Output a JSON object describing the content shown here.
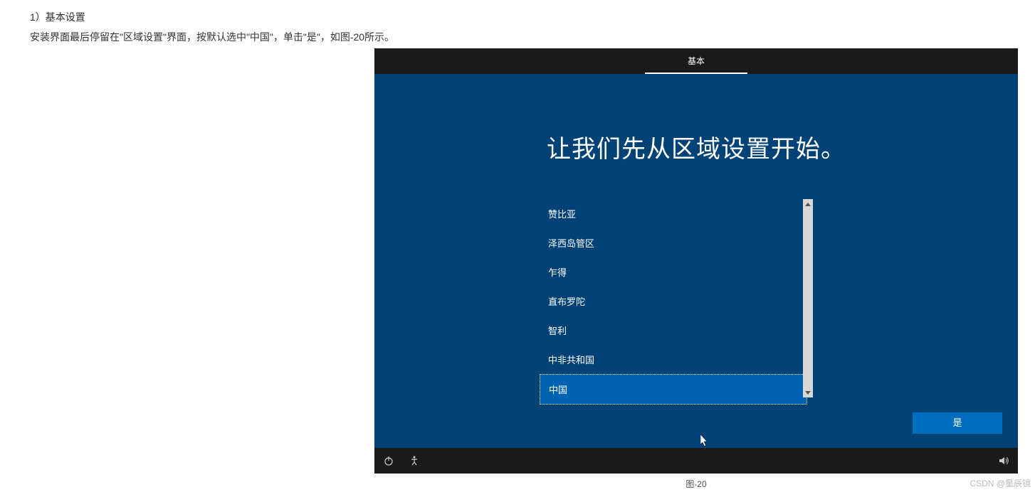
{
  "article": {
    "heading": "1）基本设置",
    "body": "安装界面最后停留在\"区域设置\"界面，按默认选中\"中国\"，单击\"是\"，如图-20所示。"
  },
  "setup": {
    "tab_label": "基本",
    "title": "让我们先从区域设置开始。",
    "regions": [
      "赞比亚",
      "泽西岛管区",
      "乍得",
      "直布罗陀",
      "智利",
      "中非共和国",
      "中国"
    ],
    "selected_region": "中国",
    "yes_button": "是"
  },
  "caption": "图-20",
  "watermark": "CSDN @星辰镜"
}
